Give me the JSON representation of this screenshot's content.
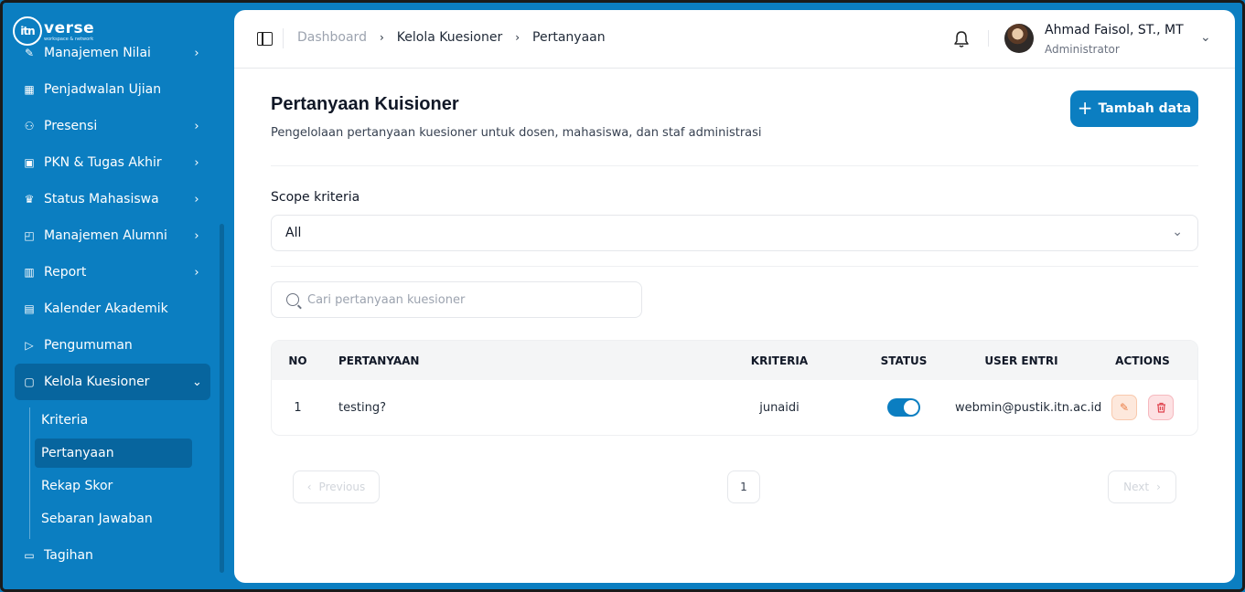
{
  "sidebar": {
    "logo": {
      "mark": "itn",
      "word": "verse",
      "tagline": "workspace & network"
    },
    "items": [
      {
        "label": "Manajemen Nilai",
        "icon": "edit-icon",
        "glyph": "✎",
        "chevron": true
      },
      {
        "label": "Penjadwalan Ujian",
        "icon": "calendar-icon",
        "glyph": "▦",
        "chevron": false
      },
      {
        "label": "Presensi",
        "icon": "user-check-icon",
        "glyph": "⚇",
        "chevron": true
      },
      {
        "label": "PKN & Tugas Akhir",
        "icon": "briefcase-icon",
        "glyph": "▣",
        "chevron": true
      },
      {
        "label": "Status Mahasiswa",
        "icon": "graduation-cap-icon",
        "glyph": "♛",
        "chevron": true
      },
      {
        "label": "Manajemen Alumni",
        "icon": "folder-user-icon",
        "glyph": "◰",
        "chevron": true
      },
      {
        "label": "Report",
        "icon": "report-icon",
        "glyph": "▥",
        "chevron": true
      },
      {
        "label": "Kalender Akademik",
        "icon": "calendar-star-icon",
        "glyph": "▤",
        "chevron": false
      },
      {
        "label": "Pengumuman",
        "icon": "announcement-icon",
        "glyph": "▷",
        "chevron": false
      },
      {
        "label": "Kelola Kuesioner",
        "icon": "clipboard-icon",
        "glyph": "▢",
        "chevron": "down",
        "active": true
      }
    ],
    "sub_items": [
      {
        "label": "Kriteria",
        "active": false
      },
      {
        "label": "Pertanyaan",
        "active": true
      },
      {
        "label": "Rekap Skor",
        "active": false
      },
      {
        "label": "Sebaran Jawaban",
        "active": false
      }
    ],
    "after_items": [
      {
        "label": "Tagihan",
        "icon": "bill-icon",
        "glyph": "▭"
      }
    ]
  },
  "header": {
    "breadcrumb": [
      "Dashboard",
      "Kelola Kuesioner",
      "Pertanyaan"
    ],
    "user_name": "Ahmad Faisol, ST., MT",
    "user_role": "Administrator"
  },
  "page": {
    "title": "Pertanyaan Kuisioner",
    "subtitle": "Pengelolaan pertanyaan kuesioner untuk dosen, mahasiswa, dan staf administrasi",
    "add_button": "Tambah data",
    "scope_label": "Scope kriteria",
    "scope_value": "All",
    "search_placeholder": "Cari pertanyaan kuesioner"
  },
  "table": {
    "headers": {
      "no": "NO",
      "question": "PERTANYAAN",
      "criteria": "KRITERIA",
      "status": "STATUS",
      "user": "USER ENTRI",
      "actions": "ACTIONS"
    },
    "rows": [
      {
        "no": "1",
        "question": "testing?",
        "criteria": "junaidi",
        "status_on": true,
        "user": "webmin@pustik.itn.ac.id"
      }
    ]
  },
  "pagination": {
    "previous": "Previous",
    "page": "1",
    "next": "Next"
  },
  "colors": {
    "brand": "#0b7ec1",
    "active": "#07659e"
  }
}
